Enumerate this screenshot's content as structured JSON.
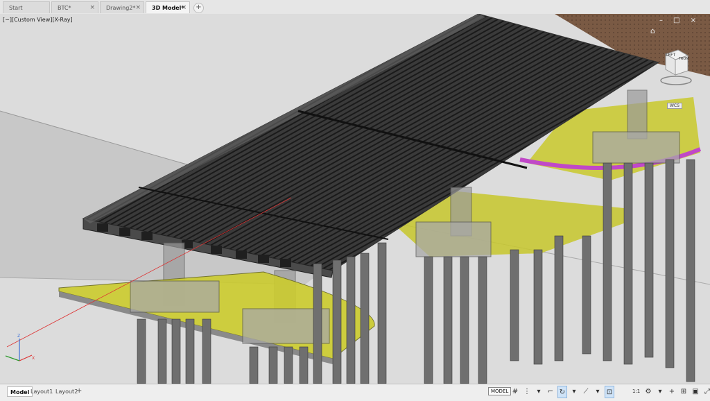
{
  "tabs": [
    {
      "label": "Start",
      "closable": false,
      "active": false
    },
    {
      "label": "BTC*",
      "closable": true,
      "active": false
    },
    {
      "label": "Drawing2*",
      "closable": true,
      "active": false
    },
    {
      "label": "3D Model*",
      "closable": true,
      "active": true
    }
  ],
  "new_tab_label": "+",
  "viewport": {
    "label": "[−][Custom View][X-Ray]",
    "controls": "– □ ×",
    "viewcube": {
      "left": "LEFT",
      "front": "FRON"
    },
    "wcs": "WCS",
    "compass_icon": "home-icon"
  },
  "layout_tabs": [
    {
      "label": "Model",
      "active": true
    },
    {
      "label": "Layout1",
      "active": false
    },
    {
      "label": "Layout2",
      "active": false
    }
  ],
  "new_layout_label": "+",
  "status": {
    "model_label": "MODEL",
    "scale": "1:1",
    "icons": [
      {
        "name": "grid-icon",
        "glyph": "#",
        "on": false
      },
      {
        "name": "snap-icon",
        "glyph": "⋮",
        "on": false
      },
      {
        "name": "dropdown-icon",
        "glyph": "▾",
        "on": false
      },
      {
        "name": "ortho-icon",
        "glyph": "⌐",
        "on": false
      },
      {
        "name": "polar-icon",
        "glyph": "↻",
        "on": true
      },
      {
        "name": "dropdown-icon",
        "glyph": "▾",
        "on": false
      },
      {
        "name": "isodraft-icon",
        "glyph": "⟋",
        "on": false
      },
      {
        "name": "dropdown-icon",
        "glyph": "▾",
        "on": false
      },
      {
        "name": "object-snap-icon",
        "glyph": "⊡",
        "on": true
      },
      {
        "name": "dropdown-icon",
        "glyph": "▾",
        "on": false
      },
      {
        "name": "3d-osnap-icon",
        "glyph": "◫",
        "on": false
      },
      {
        "name": "dynamic-ucs-icon",
        "glyph": "⋈",
        "on": true
      },
      {
        "name": "selection-cycling-icon",
        "glyph": "≡",
        "on": false
      },
      {
        "name": "lineweight-icon",
        "glyph": "⊿",
        "on": false
      },
      {
        "name": "annotation-scale-icon",
        "glyph": "⚑",
        "on": false
      },
      {
        "name": "annotation-visibility-icon",
        "glyph": "⚒",
        "on": false
      }
    ],
    "right_icons": [
      {
        "name": "workspace-gear-icon",
        "glyph": "⚙"
      },
      {
        "name": "dropdown-icon",
        "glyph": "▾"
      },
      {
        "name": "annotation-monitor-icon",
        "glyph": "+"
      },
      {
        "name": "units-icon",
        "glyph": "⊞"
      },
      {
        "name": "quick-properties-icon",
        "glyph": "▣"
      },
      {
        "name": "fullscreen-icon",
        "glyph": "⤢"
      },
      {
        "name": "customize-menu-icon",
        "glyph": "☰"
      }
    ]
  }
}
